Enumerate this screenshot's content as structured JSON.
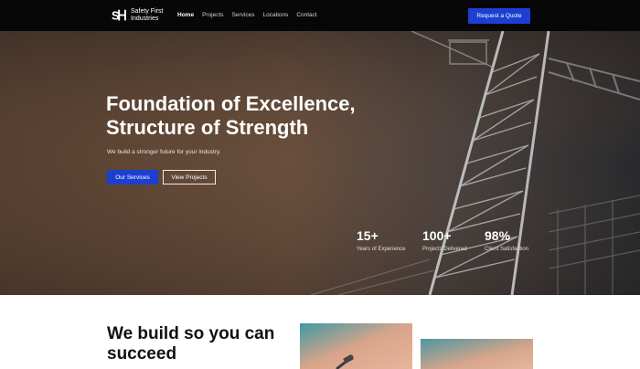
{
  "brand": {
    "name": "Safety First Industries",
    "logo_letters": "SFI"
  },
  "nav": {
    "links": [
      {
        "label": "Home",
        "active": true
      },
      {
        "label": "Projects",
        "active": false
      },
      {
        "label": "Services",
        "active": false
      },
      {
        "label": "Locations",
        "active": false
      },
      {
        "label": "Contact",
        "active": false
      }
    ],
    "cta_label": "Request a Quote"
  },
  "hero": {
    "title": "Foundation of Excellence, Structure of Strength",
    "subtitle": "We build a stronger future for your industry.",
    "primary_button": "Our Services",
    "secondary_button": "View Projects",
    "stats": [
      {
        "value": "15+",
        "label": "Years of Experience"
      },
      {
        "value": "100+",
        "label": "Projects Delivered"
      },
      {
        "value": "98%",
        "label": "Client Satisfaction"
      }
    ]
  },
  "about": {
    "title": "We build so you can succeed"
  },
  "colors": {
    "accent": "#1d3fd1",
    "nav_bg": "#070707",
    "hero_text": "#ffffff"
  }
}
